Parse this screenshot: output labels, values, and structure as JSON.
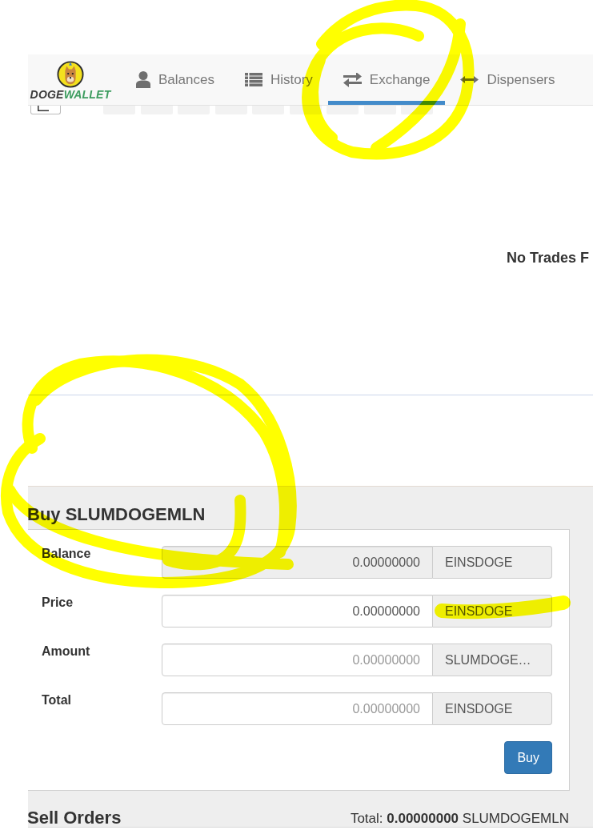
{
  "brand": {
    "mark": "DOGE",
    "accent": "WALLET"
  },
  "nav": [
    {
      "label": "Balances",
      "selected": false
    },
    {
      "label": "History",
      "selected": false
    },
    {
      "label": "Exchange",
      "selected": true
    },
    {
      "label": "Dispensers",
      "selected": false
    }
  ],
  "chart": {
    "message": "No Trades F"
  },
  "buy": {
    "title": "Buy SLUMDOGEMLN",
    "fields": [
      {
        "label": "Balance",
        "value": "0.00000000",
        "unit": "EINSDOGE",
        "disabled": true
      },
      {
        "label": "Price",
        "value": "0.00000000",
        "unit": "EINSDOGE",
        "disabled": false
      },
      {
        "label": "Amount",
        "placeholder": "0.00000000",
        "unit": "SLUMDOGE…",
        "disabled": false
      },
      {
        "label": "Total",
        "placeholder": "0.00000000",
        "unit": "EINSDOGE",
        "disabled": false
      }
    ],
    "button": "Buy"
  },
  "sell_orders": {
    "title": "Sell Orders",
    "total": "Total: **0.00000000** SLUMDOGEMLN"
  }
}
